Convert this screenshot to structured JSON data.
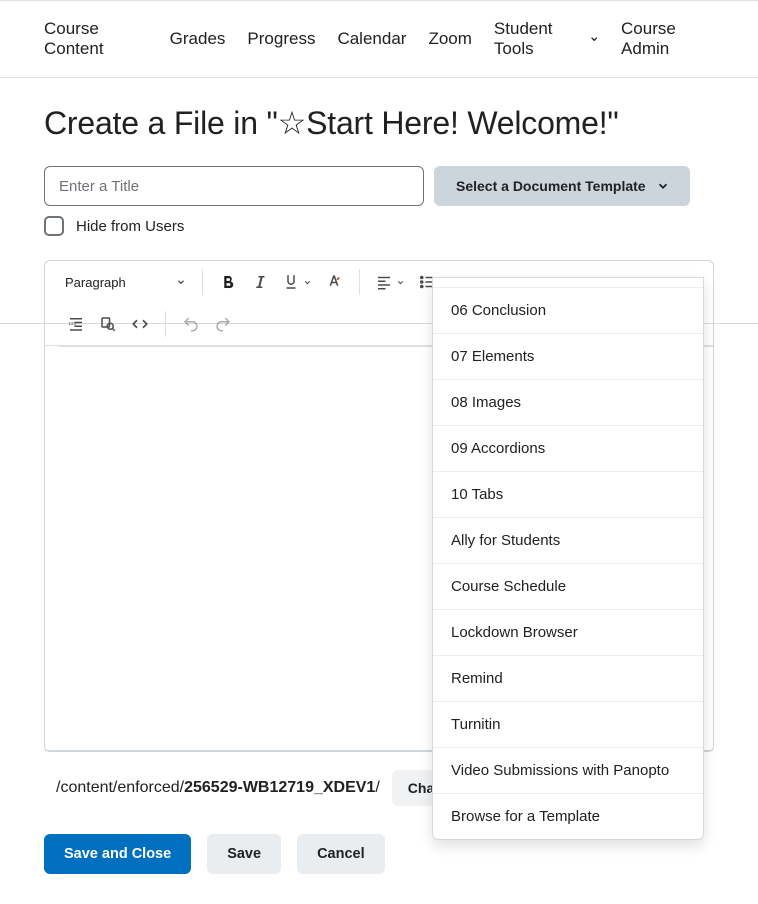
{
  "navbar": {
    "items": [
      {
        "label": "Course Content",
        "has_chev": false
      },
      {
        "label": "Grades",
        "has_chev": false
      },
      {
        "label": "Progress",
        "has_chev": false
      },
      {
        "label": "Calendar",
        "has_chev": false
      },
      {
        "label": "Zoom",
        "has_chev": false
      },
      {
        "label": "Student Tools",
        "has_chev": true
      },
      {
        "label": "Course Admin",
        "has_chev": false
      }
    ]
  },
  "page_title": "Create a File in \"☆Start Here! Welcome!\"",
  "title_input": {
    "placeholder": "Enter a Title",
    "value": ""
  },
  "template_button": "Select a Document Template",
  "hide_checkbox_label": "Hide from Users",
  "toolbar": {
    "paragraph_label": "Paragraph"
  },
  "dropdown": {
    "items": [
      "06 Conclusion",
      "07 Elements",
      "08 Images",
      "09 Accordions",
      "10 Tabs",
      "Ally for Students",
      "Course Schedule",
      "Lockdown Browser",
      "Remind",
      "Turnitin",
      "Video Submissions with Panopto",
      "Browse for a Template"
    ]
  },
  "path": {
    "prefix": "/content/enforced/",
    "course": "256529-WB12719_XDEV1",
    "suffix": "/",
    "change_label": "Change Path"
  },
  "actions": {
    "save_close": "Save and Close",
    "save": "Save",
    "cancel": "Cancel"
  }
}
